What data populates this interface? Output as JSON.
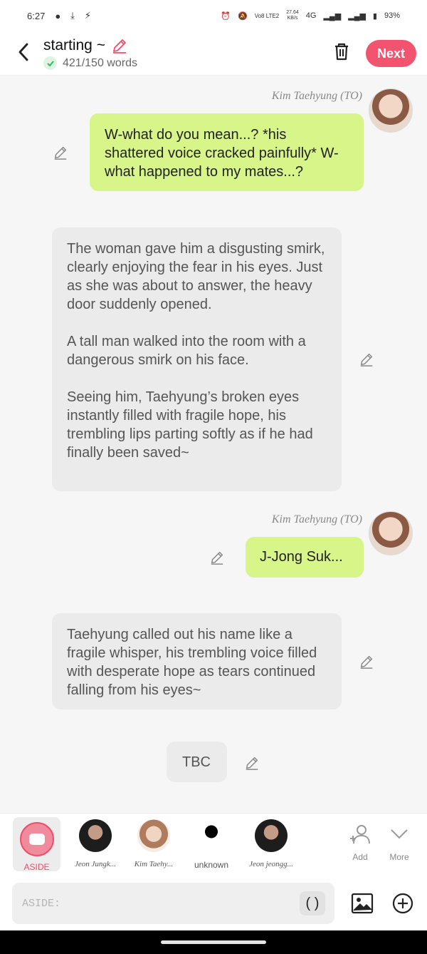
{
  "status_bar": {
    "time": "6:27",
    "speed": "27.64",
    "speed_unit": "KB/s",
    "network": "4G",
    "volte": "Vo8 LTE2",
    "battery": "93%"
  },
  "header": {
    "title": "starting ~",
    "word_count": "421/150 words",
    "next_label": "Next"
  },
  "messages": [
    {
      "speaker": "Kim Taehyung (TO)",
      "text": "W-what do you mean...? *his shattered voice cracked painfully* W-what happened to my mates...?"
    },
    {
      "text": "The woman gave him a disgusting smirk, clearly enjoying the fear in his eyes. Just as she was about to answer, the heavy door suddenly opened.\n\nA tall man walked into the room with a dangerous smirk on his face.\n\nSeeing him, Taehyung’s broken eyes instantly filled with fragile hope, his trembling lips parting softly as if he had finally been saved~"
    },
    {
      "speaker": "Kim Taehyung (TO)",
      "text": "J-Jong Suk..."
    },
    {
      "text": "Taehyung called out his name like a fragile whisper, his trembling voice filled with desperate hope as tears continued falling from his eyes~"
    },
    {
      "text": "TBC"
    }
  ],
  "characters": {
    "aside_label": "ASIDE",
    "list": [
      {
        "name": "Jeon Jungk..."
      },
      {
        "name": "Kim Taehy..."
      },
      {
        "name": "unknown"
      },
      {
        "name": "Jeon jeongg..."
      }
    ],
    "add_label": "Add",
    "more_label": "More"
  },
  "input": {
    "placeholder": "ASIDE:",
    "paren_label": "( )"
  },
  "colors": {
    "accent": "#f2536f",
    "bubble_green": "#d8f58a",
    "bubble_gray": "#ebebeb"
  }
}
